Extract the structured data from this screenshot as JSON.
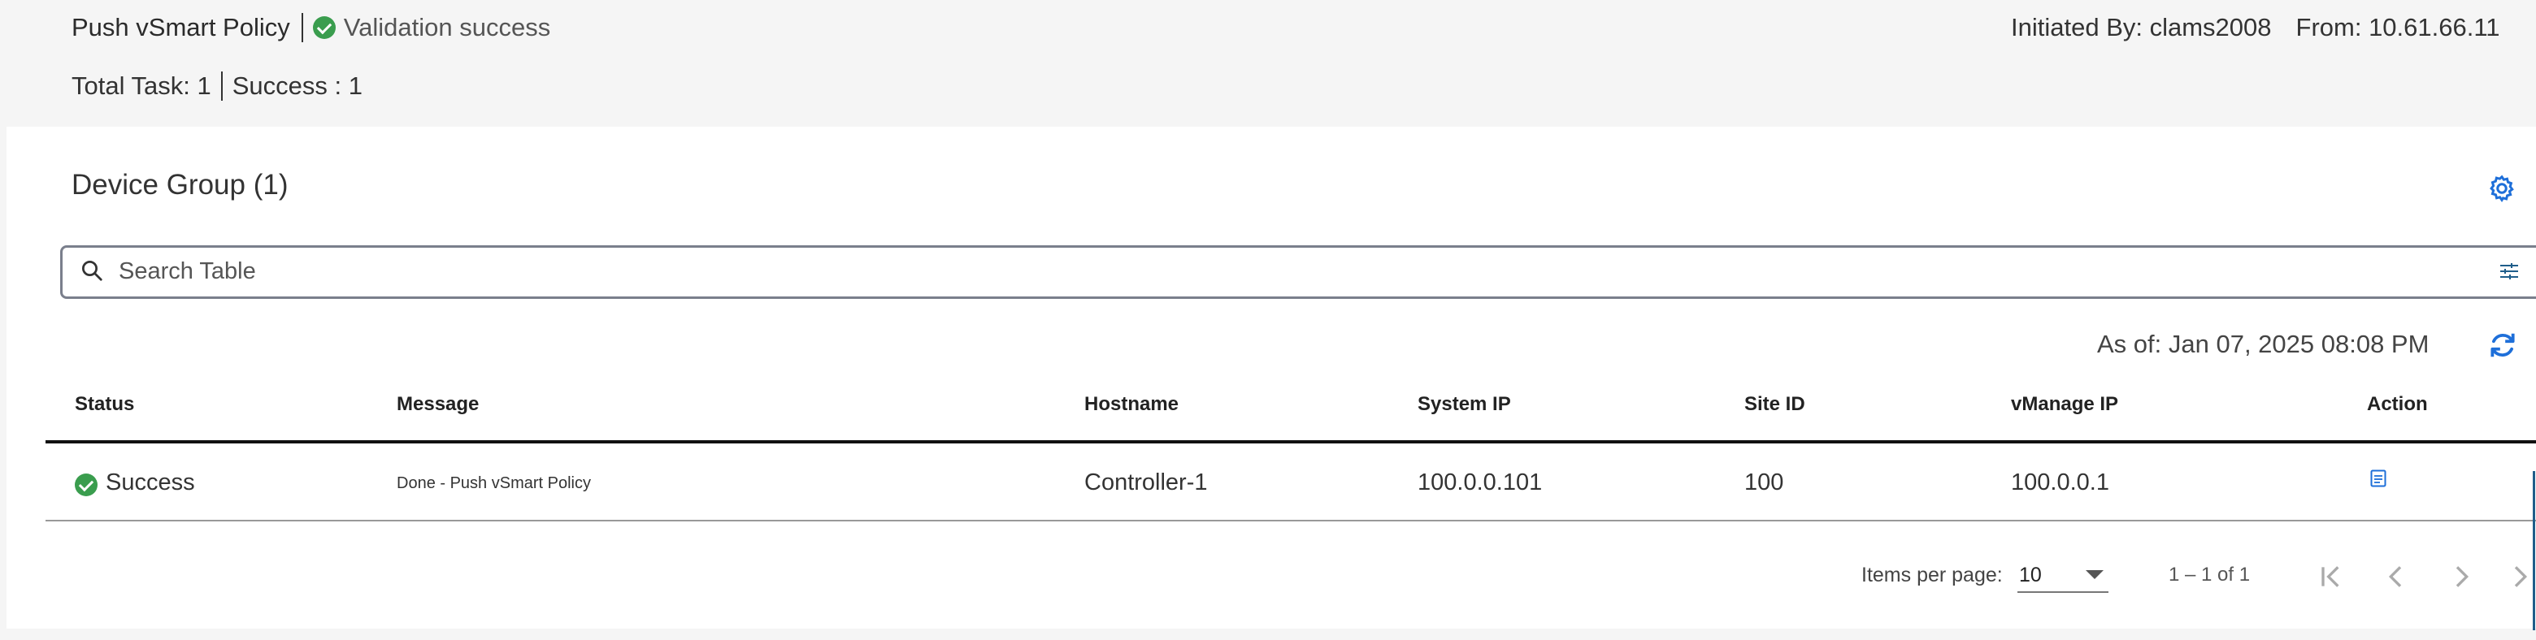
{
  "header": {
    "task_title": "Push vSmart Policy",
    "status_text": "Validation success",
    "initiated_by": "Initiated By: clams2008",
    "from": "From: 10.61.66.11",
    "total_task": "Total Task: 1",
    "success_count": "Success : 1"
  },
  "device_group": {
    "title": "Device Group (1)"
  },
  "search": {
    "placeholder": "Search Table"
  },
  "as_of": "As of: Jan 07, 2025 08:08 PM",
  "table": {
    "columns": [
      "Status",
      "Message",
      "Hostname",
      "System IP",
      "Site ID",
      "vManage IP",
      "Action"
    ],
    "rows": [
      {
        "status": "Success",
        "message": "Done - Push vSmart Policy",
        "hostname": "Controller-1",
        "system_ip": "100.0.0.101",
        "site_id": "100",
        "vmanage_ip": "100.0.0.1",
        "action_icon": "document-icon"
      }
    ]
  },
  "pagination": {
    "items_per_page_label": "Items per page:",
    "items_per_page_value": "10",
    "range": "1 – 1 of 1"
  },
  "colors": {
    "success": "#3a9d4e",
    "accent": "#1e6fd9",
    "header_bg": "#f5f5f5"
  }
}
